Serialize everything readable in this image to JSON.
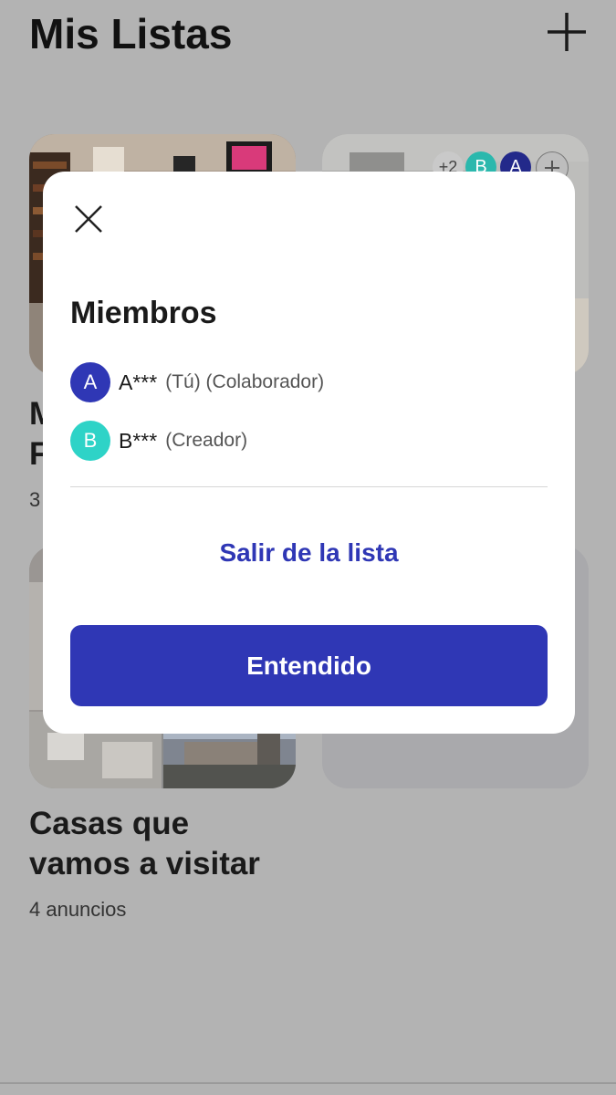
{
  "header": {
    "title": "Mis Listas"
  },
  "lists": [
    {
      "title_partial": "M\nF",
      "count_partial": "3"
    },
    {
      "title": "Casas que vamos a visitar",
      "count": "4 anuncios"
    }
  ],
  "collaborators": {
    "extra": "+2",
    "a": "A",
    "b": "B"
  },
  "modal": {
    "title": "Miembros",
    "members": [
      {
        "initial": "A",
        "name": "A***",
        "role": "(Tú) (Colaborador)",
        "color": "#2f37b5"
      },
      {
        "initial": "B",
        "name": "B***",
        "role": "(Creador)",
        "color": "#2ed3c7"
      }
    ],
    "leave_label": "Salir de la lista",
    "confirm_label": "Entendido"
  },
  "colors": {
    "accent": "#2f37b5",
    "teal": "#2ed3c7",
    "backdrop": "#b3b3b3"
  }
}
